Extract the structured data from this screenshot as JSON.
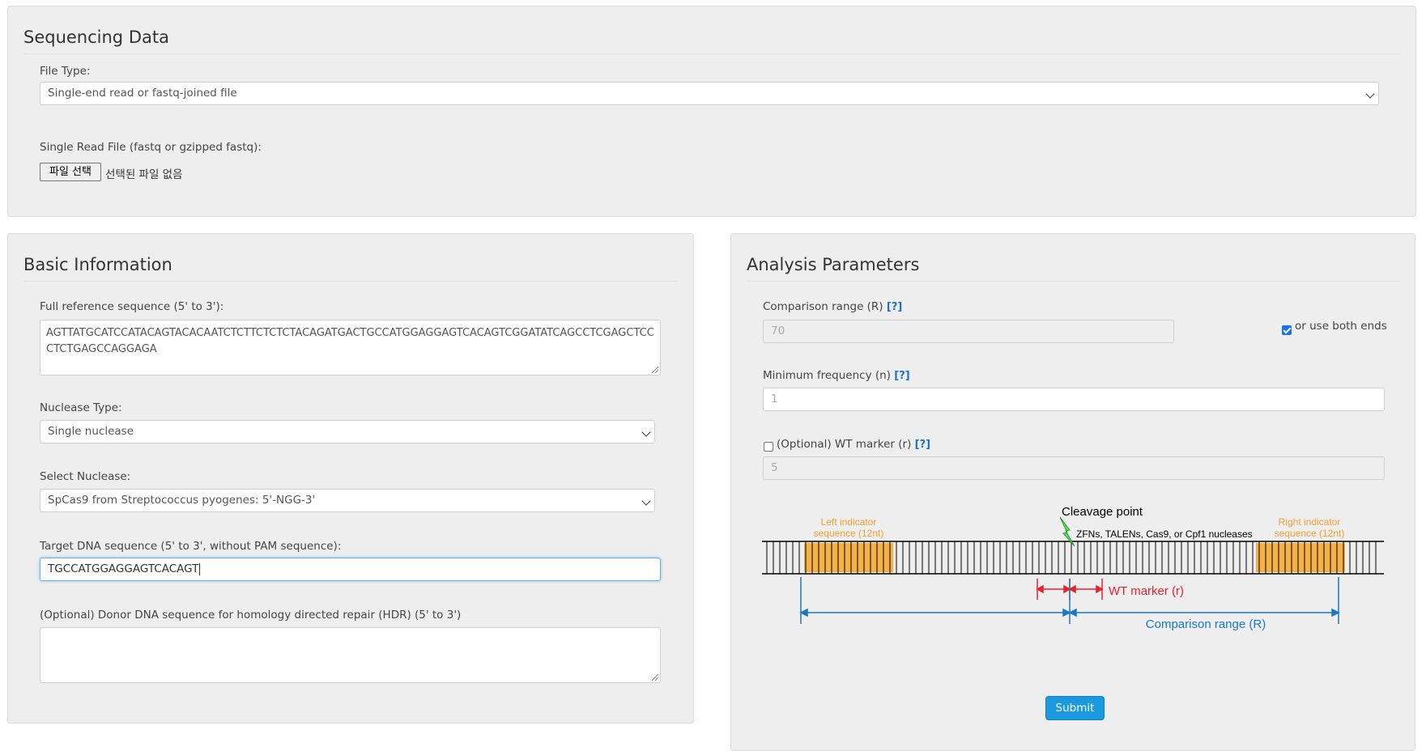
{
  "sequencing": {
    "title": "Sequencing Data",
    "file_type_label": "File Type:",
    "file_type_value": "Single-end read or fastq-joined file",
    "single_read_label": "Single Read File (fastq or gzipped fastq):",
    "choose_file_button": "파일 선택",
    "no_file_text": "선택된 파일 없음"
  },
  "basic": {
    "title": "Basic Information",
    "ref_label": "Full reference sequence (5' to 3'):",
    "ref_value": "AGTTATGCATCCATACAGTACACAATCTCTTCTCTCTACAGATGACTGCCATGGAGGAGTCACAGTCGGATATCAGCCTCGAGCTCCCTCTGAGCCAGGAGA",
    "nuclease_type_label": "Nuclease Type:",
    "nuclease_type_value": "Single nuclease",
    "select_nuclease_label": "Select Nuclease:",
    "select_nuclease_value": "SpCas9 from Streptococcus pyogenes: 5'-NGG-3'",
    "target_label": "Target DNA sequence (5' to 3', without PAM sequence):",
    "target_value": "TGCCATGGAGGAGTCACAGT",
    "donor_label": "(Optional) Donor DNA sequence for homology directed repair (HDR) (5' to 3')",
    "donor_value": ""
  },
  "analysis": {
    "title": "Analysis Parameters",
    "help_link": "[?]",
    "comparison_label": "Comparison range (R)",
    "comparison_placeholder": "70",
    "both_ends_label": "or use both ends",
    "both_ends_checked": true,
    "min_freq_label": "Minimum frequency (n)",
    "min_freq_placeholder": "1",
    "wt_marker_label": "(Optional) WT marker (r)",
    "wt_marker_checked": false,
    "wt_marker_placeholder": "5",
    "submit_label": "Submit"
  },
  "diagram": {
    "cleavage_point": "Cleavage point",
    "nucleases": "ZFNs, TALENs, Cas9, or Cpf1 nucleases",
    "left_indicator_line1": "Left indicator",
    "left_indicator_line2": "sequence (12nt)",
    "right_indicator_line1": "Right indicator",
    "right_indicator_line2": "sequence (12nt)",
    "wt_marker": "WT marker (r)",
    "comparison_range": "Comparison range (R)",
    "colors": {
      "indicator": "#f5b04a",
      "indicator_text": "#f0a030",
      "marker": "#e8212b",
      "range": "#1a78c2",
      "bolt": "#3dbb3d"
    }
  }
}
